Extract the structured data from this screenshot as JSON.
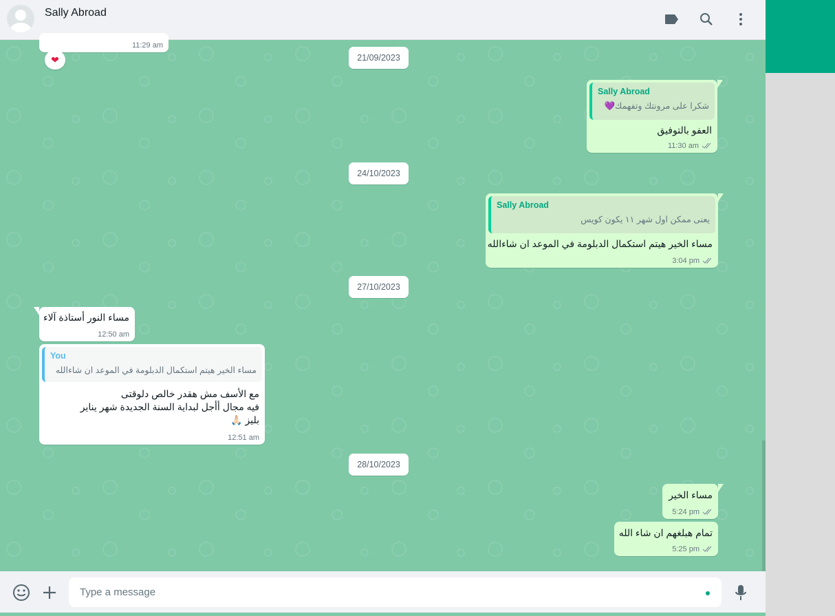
{
  "header": {
    "contact_name": "Sally Abroad"
  },
  "messages": {
    "prev_time": "11:29 am",
    "reaction": "❤",
    "m1": {
      "quote_author": "Sally Abroad",
      "quote_text": "شكرا على مرونتك وتفهمك💜",
      "text": "العفو بالتوفيق",
      "time": "11:30 am"
    },
    "m2": {
      "quote_author": "Sally Abroad",
      "quote_text": "يعنى ممكن اول شهر ١١ يكون كويس",
      "text": "مساء الخير هيتم استكمال الدبلومة في الموعد ان شاءالله",
      "time": "3:04 pm"
    },
    "m3": {
      "text": "مساء النور أستاذة آلاء",
      "time": "12:50 am"
    },
    "m4": {
      "quote_author": "You",
      "quote_text": "مساء الخير هيتم استكمال الدبلومة في الموعد ان شاءالله",
      "text": "مع الأسف مش هقدر خالص دلوقتى\nفيه مجال أأجل لبداية السنة الجديدة شهر يناير\nبليز 🙏🏻",
      "time": "12:51 am"
    },
    "m5": {
      "text": "مساء الخير",
      "time": "5:24 pm"
    },
    "m6": {
      "text": "تمام هبلغهم ان شاء الله",
      "time": "5:25 pm"
    }
  },
  "dates": {
    "d1": "21/09/2023",
    "d2": "24/10/2023",
    "d3": "27/10/2023",
    "d4": "28/10/2023"
  },
  "composer": {
    "placeholder": "Type a message"
  },
  "icons": [
    "label-icon",
    "search-icon",
    "menu-icon",
    "emoji-icon",
    "attach-icon",
    "mic-icon"
  ],
  "colors": {
    "header_bg": "#f0f2f5",
    "wallpaper": "#7fc9a7",
    "incoming": "#ffffff",
    "outgoing": "#d9fdd3",
    "accent": "#00a884"
  }
}
